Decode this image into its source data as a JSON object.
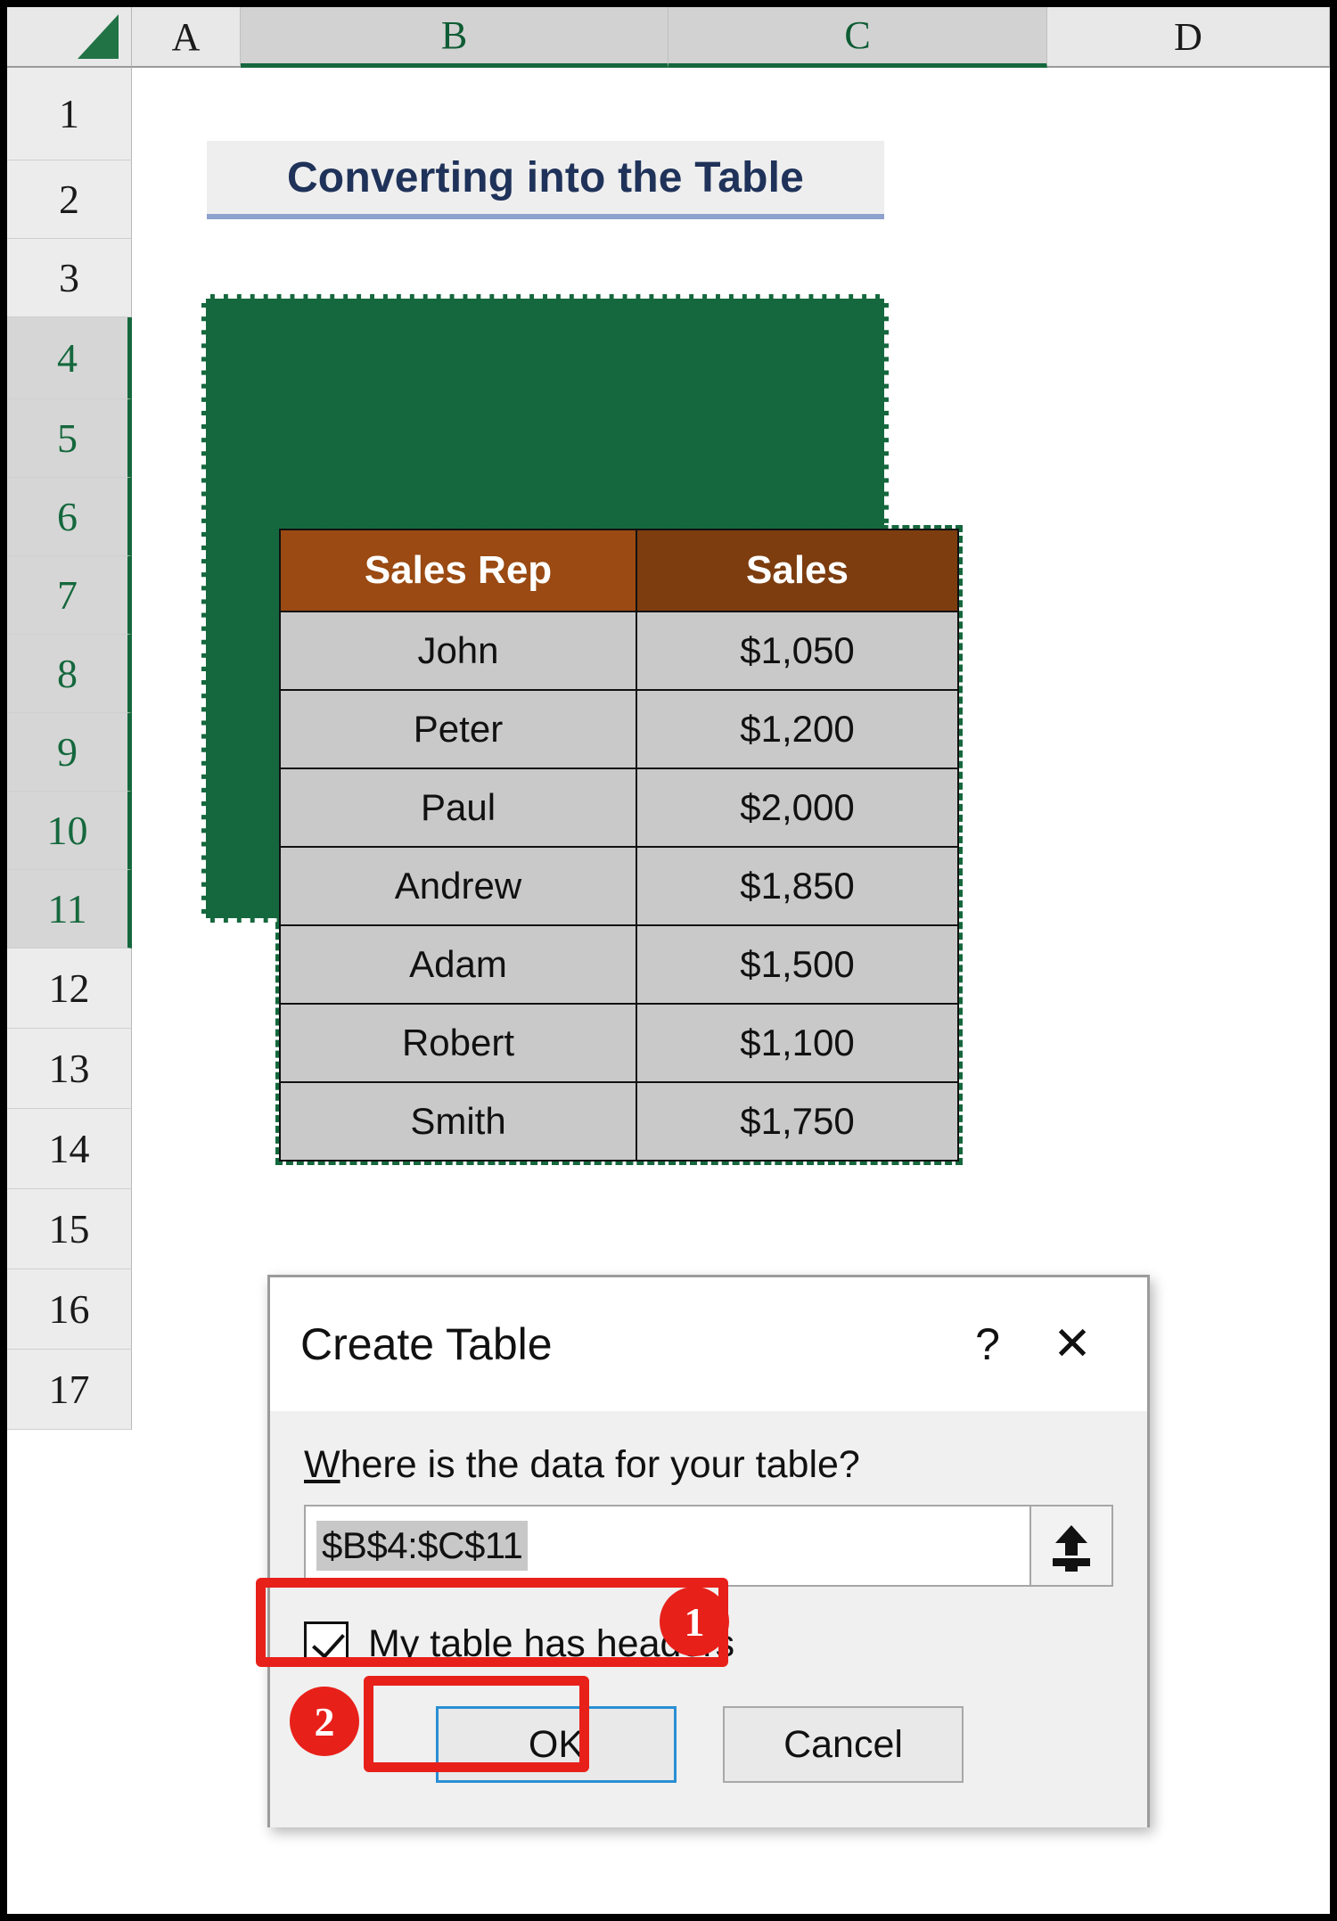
{
  "spreadsheet": {
    "column_headers": [
      "A",
      "B",
      "C",
      "D"
    ],
    "selected_columns": [
      "B",
      "C"
    ],
    "row_headers": [
      "1",
      "2",
      "3",
      "4",
      "5",
      "6",
      "7",
      "8",
      "9",
      "10",
      "11",
      "12",
      "13",
      "14",
      "15",
      "16",
      "17"
    ],
    "selected_rows": [
      "4",
      "5",
      "6",
      "7",
      "8",
      "9",
      "10",
      "11"
    ],
    "select_all_icon": "select-all-triangle-icon"
  },
  "sheet_title": "Converting into the Table",
  "table": {
    "headers": [
      "Sales Rep",
      "Sales"
    ],
    "rows": [
      {
        "rep": "John",
        "sales": "$1,050"
      },
      {
        "rep": "Peter",
        "sales": "$1,200"
      },
      {
        "rep": "Paul",
        "sales": "$2,000"
      },
      {
        "rep": "Andrew",
        "sales": "$1,850"
      },
      {
        "rep": "Adam",
        "sales": "$1,500"
      },
      {
        "rep": "Robert",
        "sales": "$1,100"
      },
      {
        "rep": "Smith",
        "sales": "$1,750"
      }
    ]
  },
  "dialog": {
    "title": "Create Table",
    "help_icon": "question-mark-icon",
    "close_icon": "close-x-icon",
    "question": "Where is the data for your table?",
    "question_accel": "W",
    "question_rest": "here is the data for your table?",
    "range_value": "$B$4:$C$11",
    "range_picker_icon": "collapse-dialog-icon",
    "checkbox": {
      "checked": true,
      "accel": "M",
      "label_rest": "y table has headers"
    },
    "ok_label": "OK",
    "cancel_label": "Cancel"
  },
  "annotations": {
    "badge_one": "1",
    "badge_two": "2",
    "accent_color": "#e8201a"
  },
  "colors": {
    "table_header_brown": "#9a4a12",
    "table_header_brown_dark": "#7d3d0f",
    "table_cell_gray": "#c9c9c9",
    "selection_green": "#15683d",
    "title_navy": "#1f3259",
    "title_underline_blue": "#8ea2ce",
    "focus_blue": "#2a8fd4"
  }
}
